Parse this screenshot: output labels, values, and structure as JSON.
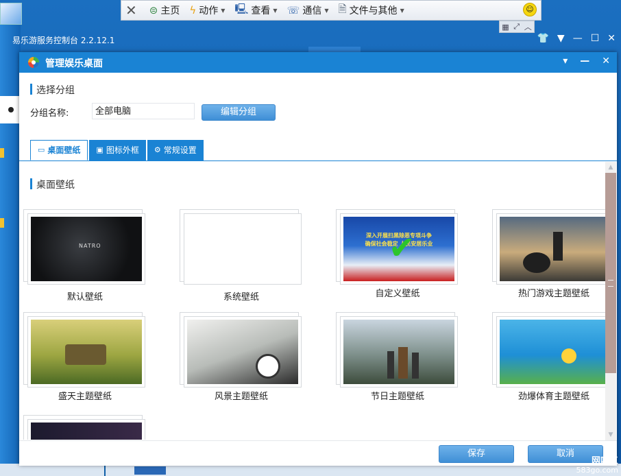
{
  "remote_toolbar": {
    "items": [
      {
        "icon": "close-icon",
        "label": ""
      },
      {
        "icon": "home-icon",
        "label": "主页"
      },
      {
        "icon": "lightning-icon",
        "label": "动作"
      },
      {
        "icon": "monitor-icon",
        "label": "查看"
      },
      {
        "icon": "phone-icon",
        "label": "通信"
      },
      {
        "icon": "file-icon",
        "label": "文件与其他"
      }
    ]
  },
  "parent_app": {
    "title": "易乐游服务控制台 2.2.12.1"
  },
  "dialog": {
    "title": "管理娱乐桌面",
    "group_section": "选择分组",
    "group_name_label": "分组名称:",
    "group_name_value": "全部电脑",
    "edit_group_button": "编辑分组",
    "tabs": [
      {
        "icon": "wallpaper-icon",
        "label": "桌面壁纸",
        "active": true
      },
      {
        "icon": "frame-icon",
        "label": "图标外框",
        "active": false
      },
      {
        "icon": "gear-icon",
        "label": "常规设置",
        "active": false
      }
    ],
    "wallpaper_section": "桌面壁纸",
    "wallpapers": [
      {
        "label": "默认壁纸",
        "image_text": "NATRO",
        "selected": false
      },
      {
        "label": "系统壁纸",
        "selected": false
      },
      {
        "label": "自定义壁纸",
        "image_text": "深入开展扫黑除恶专项斗争\n确保社会稳定 人民安居乐业",
        "selected": true
      },
      {
        "label": "热门游戏主题壁纸",
        "selected": false
      },
      {
        "label": "盛天主题壁纸",
        "selected": false
      },
      {
        "label": "风景主题壁纸",
        "selected": false
      },
      {
        "label": "节日主题壁纸",
        "selected": false
      },
      {
        "label": "劲爆体育主题壁纸",
        "selected": false
      },
      {
        "label": "",
        "selected": false
      }
    ],
    "save_button": "保存",
    "cancel_button": "取消"
  },
  "watermark": {
    "line1": "网吧三",
    "line2": "583go.com"
  },
  "colors": {
    "accent": "#1a83d4",
    "button": "#4a9ae0",
    "scroll_thumb": "#b69c96"
  }
}
